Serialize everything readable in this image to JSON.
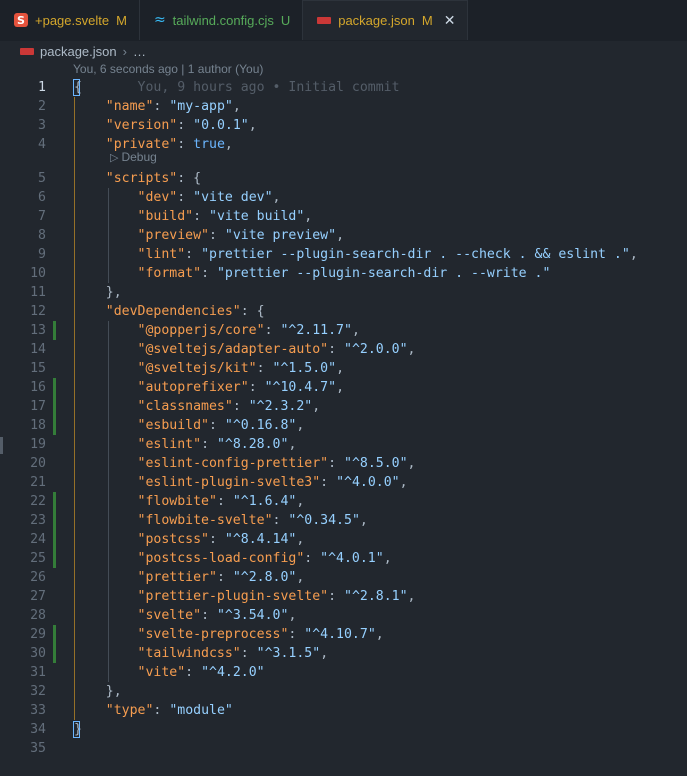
{
  "tabs": [
    {
      "name": "+page.svelte",
      "status": "M",
      "icon": "svelte-icon",
      "active": false
    },
    {
      "name": "tailwind.config.cjs",
      "status": "U",
      "icon": "tailwind-icon",
      "active": false
    },
    {
      "name": "package.json",
      "status": "M",
      "icon": "npm-icon",
      "active": true
    }
  ],
  "breadcrumb": {
    "file": "package.json",
    "more": "…"
  },
  "blame_header": "You, 6 seconds ago | 1 author (You)",
  "inline_blame": "You, 9 hours ago • Initial commit",
  "codelens": "Debug",
  "lines": [
    {
      "n": "1",
      "text": "{"
    },
    {
      "n": "2",
      "text": "    \"name\": \"my-app\","
    },
    {
      "n": "3",
      "text": "    \"version\": \"0.0.1\","
    },
    {
      "n": "4",
      "text": "    \"private\": true,"
    },
    {
      "n": "5",
      "text": "    \"scripts\": {"
    },
    {
      "n": "6",
      "text": "        \"dev\": \"vite dev\","
    },
    {
      "n": "7",
      "text": "        \"build\": \"vite build\","
    },
    {
      "n": "8",
      "text": "        \"preview\": \"vite preview\","
    },
    {
      "n": "9",
      "text": "        \"lint\": \"prettier --plugin-search-dir . --check . && eslint .\","
    },
    {
      "n": "10",
      "text": "        \"format\": \"prettier --plugin-search-dir . --write .\""
    },
    {
      "n": "11",
      "text": "    },"
    },
    {
      "n": "12",
      "text": "    \"devDependencies\": {"
    },
    {
      "n": "13",
      "text": "        \"@popperjs/core\": \"^2.11.7\","
    },
    {
      "n": "14",
      "text": "        \"@sveltejs/adapter-auto\": \"^2.0.0\","
    },
    {
      "n": "15",
      "text": "        \"@sveltejs/kit\": \"^1.5.0\","
    },
    {
      "n": "16",
      "text": "        \"autoprefixer\": \"^10.4.7\","
    },
    {
      "n": "17",
      "text": "        \"classnames\": \"^2.3.2\","
    },
    {
      "n": "18",
      "text": "        \"esbuild\": \"^0.16.8\","
    },
    {
      "n": "19",
      "text": "        \"eslint\": \"^8.28.0\","
    },
    {
      "n": "20",
      "text": "        \"eslint-config-prettier\": \"^8.5.0\","
    },
    {
      "n": "21",
      "text": "        \"eslint-plugin-svelte3\": \"^4.0.0\","
    },
    {
      "n": "22",
      "text": "        \"flowbite\": \"^1.6.4\","
    },
    {
      "n": "23",
      "text": "        \"flowbite-svelte\": \"^0.34.5\","
    },
    {
      "n": "24",
      "text": "        \"postcss\": \"^8.4.14\","
    },
    {
      "n": "25",
      "text": "        \"postcss-load-config\": \"^4.0.1\","
    },
    {
      "n": "26",
      "text": "        \"prettier\": \"^2.8.0\","
    },
    {
      "n": "27",
      "text": "        \"prettier-plugin-svelte\": \"^2.8.1\","
    },
    {
      "n": "28",
      "text": "        \"svelte\": \"^3.54.0\","
    },
    {
      "n": "29",
      "text": "        \"svelte-preprocess\": \"^4.10.7\","
    },
    {
      "n": "30",
      "text": "        \"tailwindcss\": \"^3.1.5\","
    },
    {
      "n": "31",
      "text": "        \"vite\": \"^4.2.0\""
    },
    {
      "n": "32",
      "text": "    },"
    },
    {
      "n": "33",
      "text": "    \"type\": \"module\""
    },
    {
      "n": "34",
      "text": "}"
    },
    {
      "n": "35",
      "text": ""
    }
  ],
  "changed_lines": [
    "13",
    "16",
    "17",
    "18",
    "22",
    "23",
    "24",
    "25",
    "29",
    "30"
  ]
}
